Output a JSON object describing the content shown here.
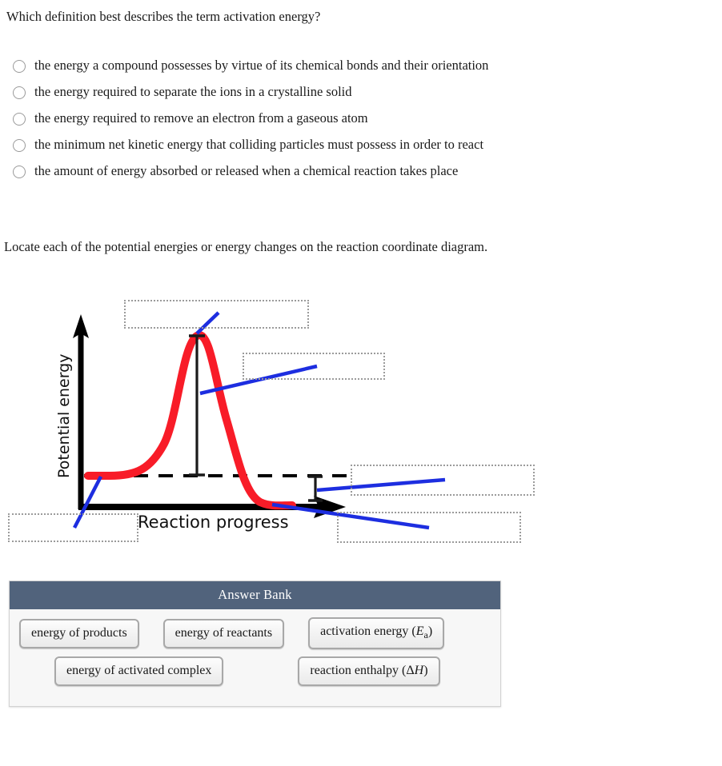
{
  "question": {
    "stem": "Which definition best describes the term activation energy?",
    "choices": [
      "the energy a compound possesses by virtue of its chemical bonds and their orientation",
      "the energy required to separate the ions in a crystalline solid",
      "the energy required to remove an electron from a gaseous atom",
      "the minimum net kinetic energy that colliding particles must possess in order to react",
      "the amount of energy absorbed or released when a chemical reaction takes place"
    ]
  },
  "instruction": "Locate each of the potential energies or energy changes on the reaction coordinate diagram.",
  "diagram": {
    "y_axis_label": "Potential energy",
    "x_axis_label": "Reaction progress",
    "drop_zones": [
      {
        "name": "drop-zone-peak",
        "value": ""
      },
      {
        "name": "drop-zone-activation",
        "value": ""
      },
      {
        "name": "drop-zone-enthalpy",
        "value": ""
      },
      {
        "name": "drop-zone-reactants",
        "value": ""
      },
      {
        "name": "drop-zone-products",
        "value": ""
      }
    ],
    "colors": {
      "curve": "#f81c28",
      "connector": "#1d2ee0",
      "axis": "#000000",
      "dropzone_border": "#9b9b9b"
    }
  },
  "chart_data": {
    "type": "line",
    "title": "",
    "xlabel": "Reaction progress",
    "ylabel": "Potential energy",
    "grid": false,
    "legend": null,
    "annotations": [
      {
        "label": "energy of reactants",
        "kind": "level",
        "y": 0.28
      },
      {
        "label": "energy of activated complex",
        "kind": "peak",
        "y": 1.0
      },
      {
        "label": "activation energy (Ea)",
        "kind": "span",
        "from_y": 0.28,
        "to_y": 1.0
      },
      {
        "label": "reaction enthalpy (ΔH)",
        "kind": "span",
        "from_y": 0.0,
        "to_y": 0.28
      },
      {
        "label": "energy of products",
        "kind": "level",
        "y": 0.0
      }
    ],
    "series": [
      {
        "name": "reaction coordinate",
        "x": [
          0.0,
          0.06,
          0.14,
          0.22,
          0.3,
          0.38,
          0.44,
          0.5,
          0.56,
          0.62,
          0.7,
          0.78,
          0.86,
          1.0
        ],
        "y": [
          0.28,
          0.28,
          0.3,
          0.37,
          0.58,
          0.85,
          0.98,
          1.0,
          0.93,
          0.72,
          0.38,
          0.1,
          0.02,
          0.0
        ]
      }
    ],
    "xlim": [
      0,
      1
    ],
    "ylim": [
      0,
      1.08
    ]
  },
  "answer_bank": {
    "title": "Answer Bank",
    "row1": [
      {
        "label": "energy of products"
      },
      {
        "label": "energy of reactants"
      },
      {
        "label": "activation energy (",
        "italic": "E",
        "subscript": "a",
        "suffix": ")"
      }
    ],
    "row2": [
      {
        "label": "energy of activated complex"
      },
      {
        "label": "reaction enthalpy (Δ",
        "italic": "H",
        "suffix": ")"
      }
    ]
  }
}
